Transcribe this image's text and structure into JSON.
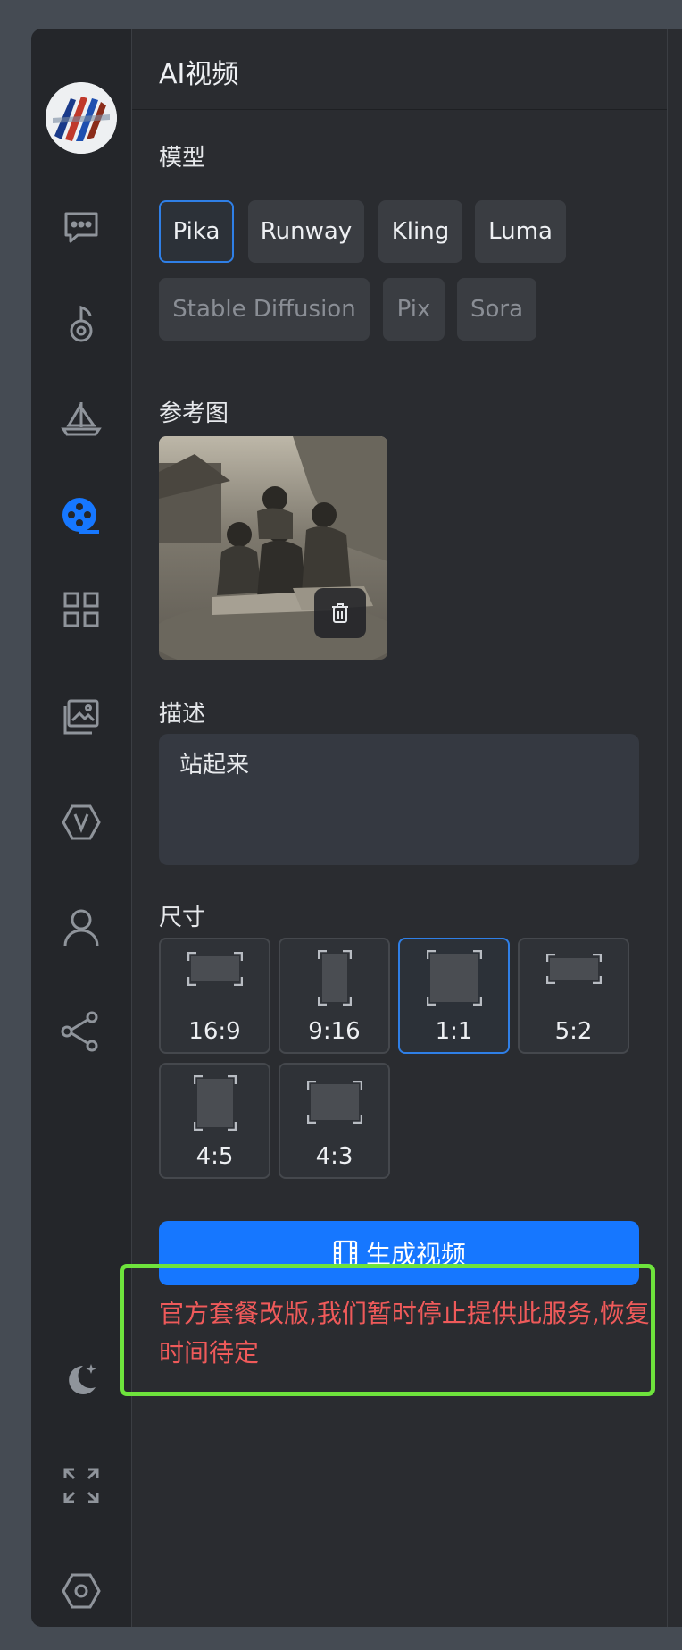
{
  "header": {
    "title": "AI视频"
  },
  "model": {
    "label": "模型",
    "options": [
      "Pika",
      "Runway",
      "Kling",
      "Luma",
      "Stable Diffusion",
      "Pix",
      "Sora"
    ],
    "selected": "Pika"
  },
  "reference": {
    "label": "参考图"
  },
  "description": {
    "label": "描述",
    "value": "站起来"
  },
  "size": {
    "label": "尺寸",
    "options": [
      "16:9",
      "9:16",
      "1:1",
      "5:2",
      "4:5",
      "4:3"
    ],
    "selected": "1:1"
  },
  "generate": {
    "label": "生成视频"
  },
  "notice": {
    "text": "官方套餐改版,我们暂时停止提供此服务,恢复时间待定"
  },
  "sidebar": {
    "icons": [
      "chat-icon",
      "music-icon",
      "sailboat-icon",
      "video-icon",
      "apps-icon",
      "gallery-icon",
      "v-badge-icon",
      "user-icon",
      "share-icon",
      "moon-icon",
      "fullscreen-icon",
      "settings-icon"
    ]
  },
  "colors": {
    "accent": "#1677ff",
    "notice": "#ef5a5a",
    "highlight": "#6ee33c"
  }
}
